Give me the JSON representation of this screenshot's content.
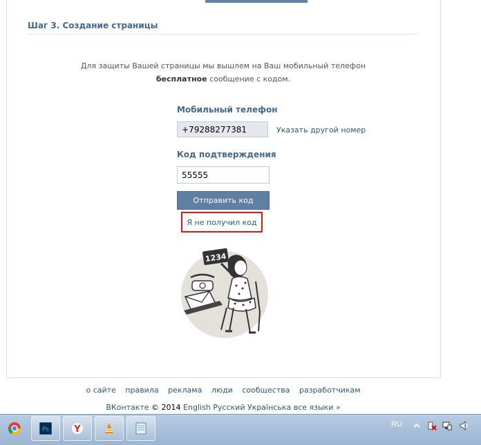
{
  "step": {
    "title": "Шаг 3. Создание страницы"
  },
  "info": {
    "line1": "Для защиты Вашей страницы мы вышлем на Ваш мобильный телефон",
    "bold": "бесплатное",
    "rest": " сообщение с кодом."
  },
  "phone": {
    "label": "Мобильный телефон",
    "value": "+79288277381",
    "change_link": "Указать другой номер"
  },
  "code": {
    "label": "Код подтверждения",
    "value": "55555"
  },
  "send_button": "Отправить код",
  "not_received_link": "Я не получил код",
  "illustration": {
    "sign_text": "1234"
  },
  "footer": {
    "links": [
      "о сайте",
      "правила",
      "реклама",
      "люди",
      "сообщества",
      "разработчикам"
    ],
    "brand": "ВКонтакте",
    "copyright": " © 2014 ",
    "languages": [
      "English",
      "Русский",
      "Українська",
      "все языки »"
    ]
  },
  "taskbar": {
    "language": "RU"
  },
  "colors": {
    "accent": "#45688e",
    "link": "#2b587a",
    "button": "#5f7fa3",
    "highlight": "#e01616"
  }
}
